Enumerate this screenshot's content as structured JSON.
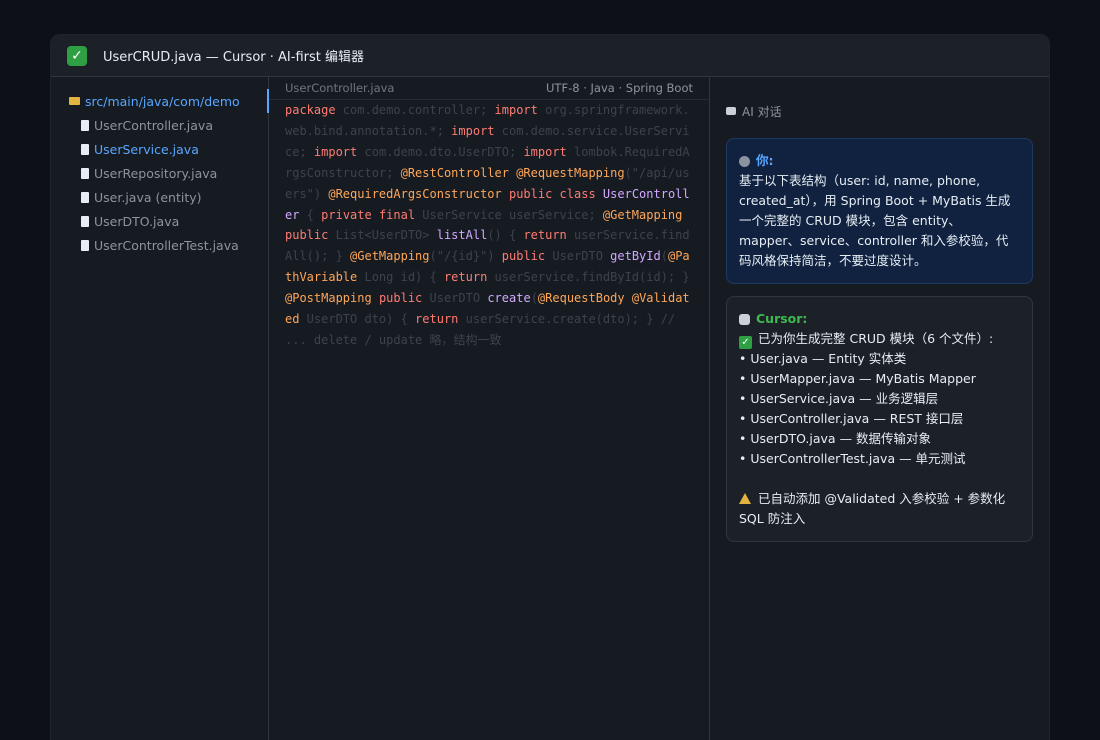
{
  "window": {
    "title": "UserCRUD.java — Cursor · AI-first 编辑器"
  },
  "explorer": {
    "folder": "src/main/java/com/demo",
    "files": [
      {
        "label": "UserController.java",
        "active": false
      },
      {
        "label": "UserService.java",
        "active": true
      },
      {
        "label": "UserRepository.java",
        "active": false
      },
      {
        "label": "User.java (entity)",
        "active": false
      },
      {
        "label": "UserDTO.java",
        "active": false
      },
      {
        "label": "UserControllerTest.java",
        "active": false
      }
    ]
  },
  "editor": {
    "filename": "UserController.java",
    "meta": "UTF-8 · Java · Spring Boot",
    "tokens": [
      [
        "kw",
        "package"
      ],
      [
        "t",
        " com.demo.controller; "
      ],
      [
        "kw",
        "import"
      ],
      [
        "t",
        " org.springframework.web.bind.annotation.*; "
      ],
      [
        "kw",
        "import"
      ],
      [
        "t",
        " com.demo.service.UserService; "
      ],
      [
        "kw",
        "import"
      ],
      [
        "t",
        " com.demo.dto.UserDTO; "
      ],
      [
        "kw",
        "import"
      ],
      [
        "t",
        " lombok.RequiredArgsConstructor; "
      ],
      [
        "an",
        "@RestController"
      ],
      [
        "t",
        " "
      ],
      [
        "an",
        "@RequestMapping"
      ],
      [
        "t",
        "(\"/api/users\") "
      ],
      [
        "an",
        "@RequiredArgsConstructor"
      ],
      [
        "t",
        " "
      ],
      [
        "kw",
        "public class"
      ],
      [
        "t",
        " "
      ],
      [
        "cl",
        "UserController"
      ],
      [
        "t",
        " { "
      ],
      [
        "kw",
        "private final"
      ],
      [
        "t",
        " UserService userService; "
      ],
      [
        "an",
        "@GetMapping"
      ],
      [
        "t",
        " "
      ],
      [
        "kw",
        "public"
      ],
      [
        "t",
        " List<UserDTO> "
      ],
      [
        "cl",
        "listAll"
      ],
      [
        "t",
        "() { "
      ],
      [
        "kw",
        "return"
      ],
      [
        "t",
        " userService.findAll(); } "
      ],
      [
        "an",
        "@GetMapping"
      ],
      [
        "t",
        "(\"/{id}\") "
      ],
      [
        "kw",
        "public"
      ],
      [
        "t",
        " UserDTO "
      ],
      [
        "cl",
        "getById"
      ],
      [
        "t",
        "("
      ],
      [
        "an",
        "@PathVariable"
      ],
      [
        "t",
        " Long id) { "
      ],
      [
        "kw",
        "return"
      ],
      [
        "t",
        " userService.findById(id); } "
      ],
      [
        "an",
        "@PostMapping"
      ],
      [
        "t",
        " "
      ],
      [
        "kw",
        "public"
      ],
      [
        "t",
        " UserDTO "
      ],
      [
        "cl",
        "create"
      ],
      [
        "t",
        "("
      ],
      [
        "an",
        "@RequestBody"
      ],
      [
        "t",
        " "
      ],
      [
        "an",
        "@Validated"
      ],
      [
        "t",
        " UserDTO dto) { "
      ],
      [
        "kw",
        "return"
      ],
      [
        "t",
        " userService.create(dto); } // ... delete / update 略，结构一致"
      ]
    ]
  },
  "chat": {
    "title": "AI 对话",
    "user": {
      "name": "你:",
      "text": "基于以下表结构（user: id, name, phone, created_at），用 Spring Boot + MyBatis 生成一个完整的 CRUD 模块，包含 entity、mapper、service、controller 和入参校验，代码风格保持简洁，不要过度设计。"
    },
    "ai": {
      "name": "Cursor:",
      "summary": "已为你生成完整 CRUD 模块（6 个文件）:",
      "items": [
        "• User.java — Entity 实体类",
        "• UserMapper.java — MyBatis Mapper",
        "• UserService.java — 业务逻辑层",
        "• UserController.java — REST 接口层",
        "• UserDTO.java — 数据传输对象",
        "• UserControllerTest.java — 单元测试"
      ],
      "note": "已自动添加 @Validated 入参校验 + 参数化 SQL 防注入"
    }
  }
}
